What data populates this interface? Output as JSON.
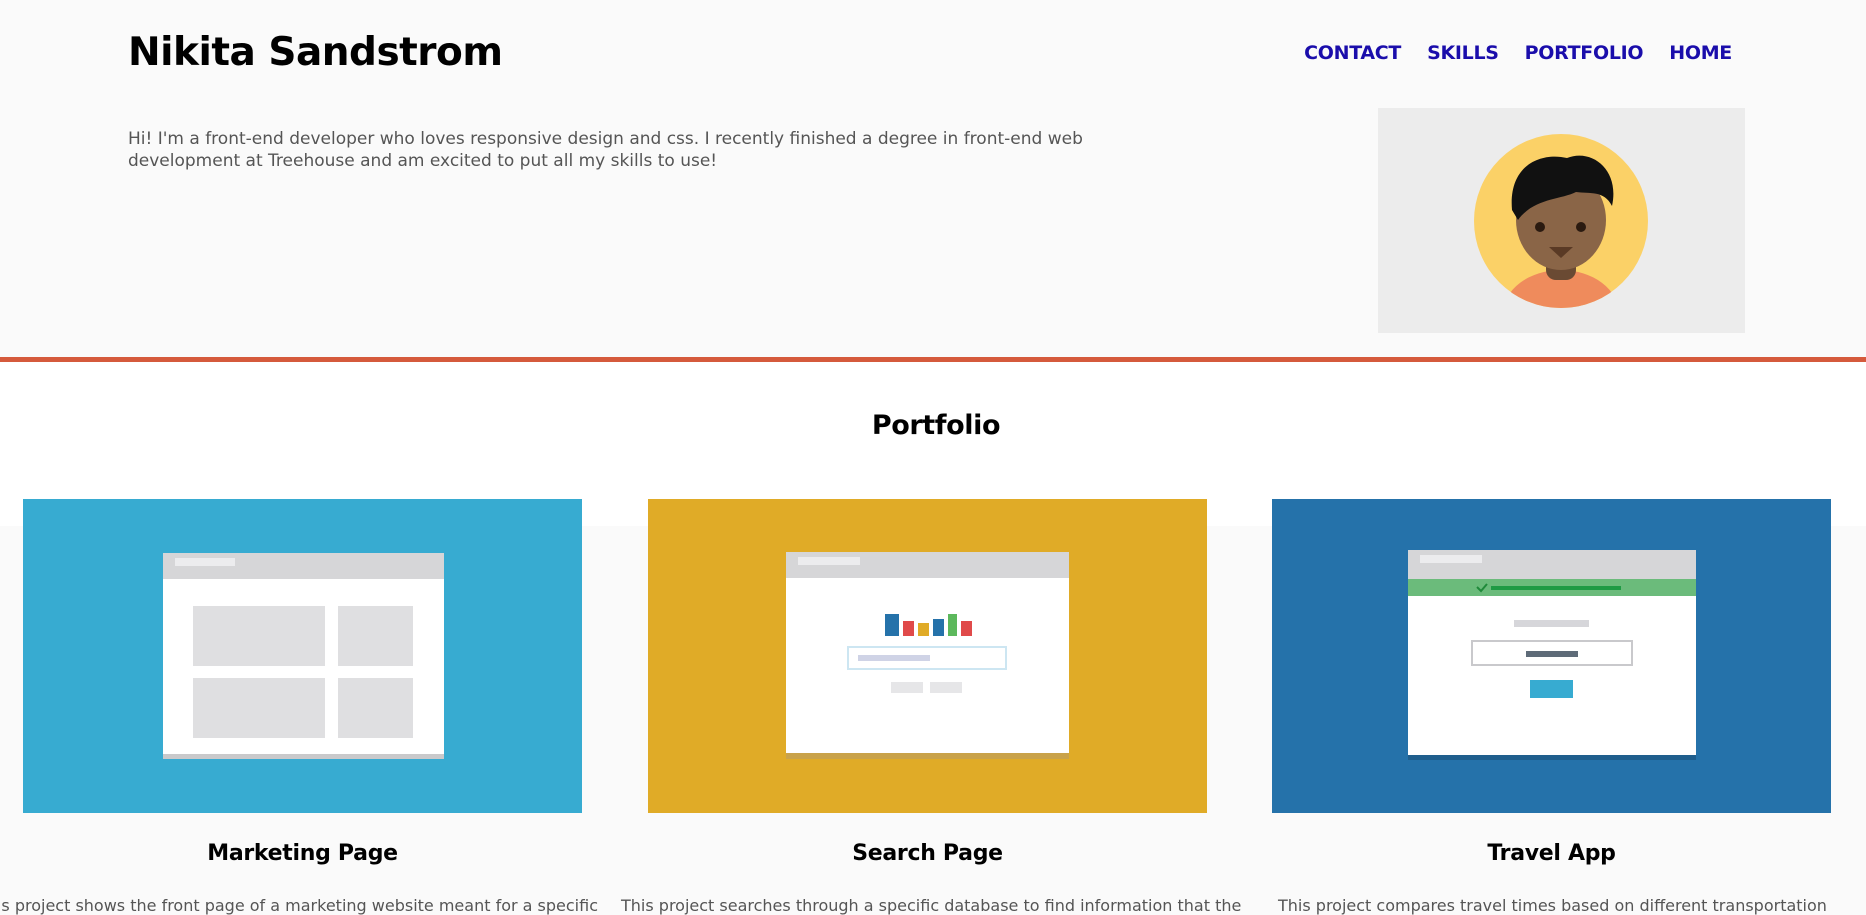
{
  "header": {
    "site_name": "Nikita Sandstrom",
    "nav": [
      {
        "label": "CONTACT"
      },
      {
        "label": "SKILLS"
      },
      {
        "label": "PORTFOLIO"
      },
      {
        "label": "HOME"
      }
    ],
    "intro": "Hi! I'm a front-end developer who loves responsive design and css. I recently finished a degree in front-end web development at Treehouse and am excited to put all my skills to use!",
    "avatar_icon": "avatar-illustration"
  },
  "portfolio": {
    "title": "Portfolio",
    "projects": [
      {
        "name": "Marketing Page",
        "description": "This project shows the front page of a marketing website meant for a specific",
        "color": "#37abd1",
        "icon": "browser-layout-illustration"
      },
      {
        "name": "Search Page",
        "description": "This project searches through a specific database to find information that the",
        "color": "#e0ab27",
        "icon": "browser-search-illustration"
      },
      {
        "name": "Travel App",
        "description": "This project compares travel times based on different transportation",
        "color": "#2572aa",
        "icon": "browser-form-illustration"
      }
    ]
  },
  "colors": {
    "accent_divider": "#d55a3c",
    "nav_link": "#1a0dab"
  }
}
